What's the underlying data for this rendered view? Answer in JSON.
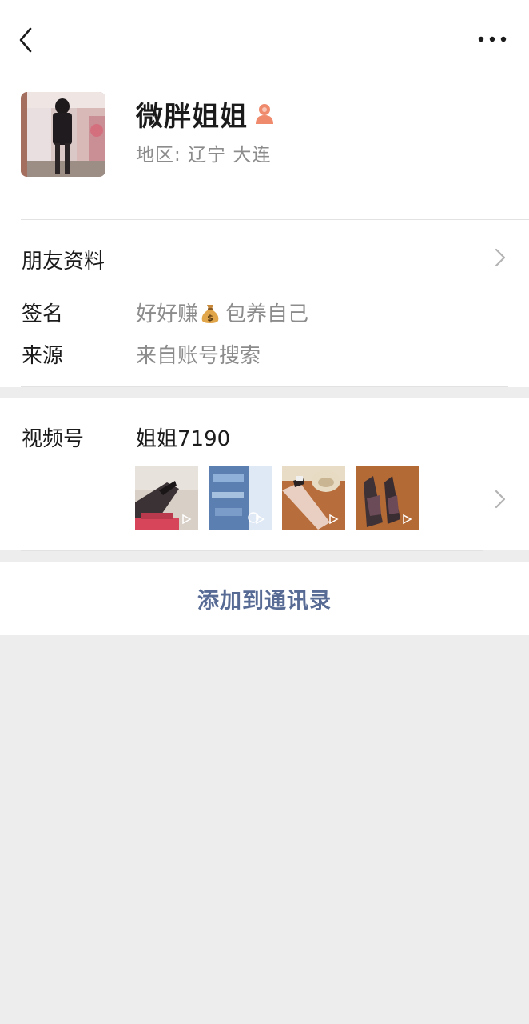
{
  "nav": {
    "back_icon": "chevron-left-icon",
    "more_icon": "more-dots-icon"
  },
  "profile": {
    "nickname": "微胖姐姐",
    "gender_icon": "female-icon",
    "region": "地区:  辽宁  大连"
  },
  "friend_info": {
    "label": "朋友资料"
  },
  "signature": {
    "label": "签名",
    "text_before": "好好赚",
    "emoji": "money-bag-icon",
    "text_after": "包养自己"
  },
  "source": {
    "label": "来源",
    "value": "来自账号搜索"
  },
  "channels": {
    "label": "视频号",
    "name": "姐姐7190",
    "thumbnails": [
      "video-thumb-1",
      "video-thumb-2",
      "video-thumb-3",
      "video-thumb-4"
    ]
  },
  "actions": {
    "add_contact": "添加到通讯录"
  },
  "colors": {
    "link": "#576b95",
    "background": "#ededed",
    "secondary_text": "#8c8c8c",
    "gender_icon": "#f08a6c"
  }
}
